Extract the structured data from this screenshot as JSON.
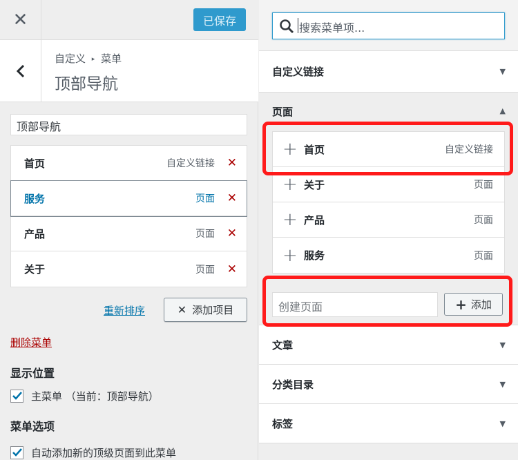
{
  "header": {
    "close_glyph": "✕",
    "saved_label": "已保存"
  },
  "title_panel": {
    "breadcrumb_parent": "自定义",
    "breadcrumb_sep": "▸",
    "breadcrumb_child": "菜单",
    "title": "顶部导航"
  },
  "menu": {
    "name_value": "顶部导航",
    "items": [
      {
        "title": "首页",
        "type": "自定义链接"
      },
      {
        "title": "服务",
        "type": "页面"
      },
      {
        "title": "产品",
        "type": "页面"
      },
      {
        "title": "关于",
        "type": "页面"
      }
    ],
    "delete_glyph": "✕",
    "reorder_label": "重新排序",
    "add_items_label": "添加项目",
    "delete_menu_label": "删除菜单"
  },
  "locations": {
    "heading": "显示位置",
    "primary_label": "主菜单 （当前：顶部导航）"
  },
  "options": {
    "heading": "菜单选项",
    "auto_add_label": "自动添加新的顶级页面到此菜单"
  },
  "search": {
    "placeholder": "搜索菜单项..."
  },
  "accordion": {
    "custom_links": "自定义链接",
    "pages": "页面",
    "posts": "文章",
    "categories": "分类目录",
    "tags": "标签",
    "arrow_down": "▼",
    "arrow_up": "▲"
  },
  "pages_list": [
    {
      "title": "首页",
      "type": "自定义链接"
    },
    {
      "title": "关于",
      "type": "页面"
    },
    {
      "title": "产品",
      "type": "页面"
    },
    {
      "title": "服务",
      "type": "页面"
    }
  ],
  "create_page": {
    "placeholder": "创建页面",
    "add_label": "添加"
  },
  "colors": {
    "accent": "#0073aa",
    "saved_button": "#2f9acd",
    "delete": "#aa0000",
    "highlight": "#ff1a1a"
  }
}
